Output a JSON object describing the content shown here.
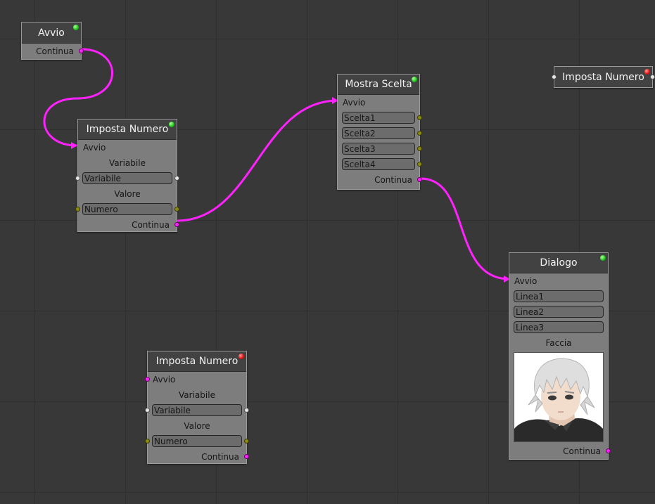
{
  "nodes": {
    "avvio": {
      "title": "Avvio",
      "status": "green",
      "continua": "Continua"
    },
    "imposta1": {
      "title": "Imposta Numero",
      "status": "green",
      "avvio": "Avvio",
      "variabile_label": "Variabile",
      "variabile_field": "Variabile",
      "valore_label": "Valore",
      "numero_field": "Numero",
      "continua": "Continua"
    },
    "mostra": {
      "title": "Mostra Scelta",
      "status": "green",
      "avvio": "Avvio",
      "choices": [
        "Scelta1",
        "Scelta2",
        "Scelta3",
        "Scelta4"
      ],
      "continua": "Continua"
    },
    "imposta_collapsed": {
      "title": "Imposta Numero",
      "status": "red"
    },
    "imposta2": {
      "title": "Imposta Numero",
      "status": "red",
      "avvio": "Avvio",
      "variabile_label": "Variabile",
      "variabile_field": "Variabile",
      "valore_label": "Valore",
      "numero_field": "Numero",
      "continua": "Continua"
    },
    "dialogo": {
      "title": "Dialogo",
      "status": "green",
      "avvio": "Avvio",
      "lines": [
        "Linea1",
        "Linea2",
        "Linea3"
      ],
      "faccia_label": "Faccia",
      "continua": "Continua"
    }
  },
  "colors": {
    "wire": "#ff22ff",
    "background": "#383838",
    "node_body": "#7d7d7d",
    "node_header": "#424242"
  }
}
